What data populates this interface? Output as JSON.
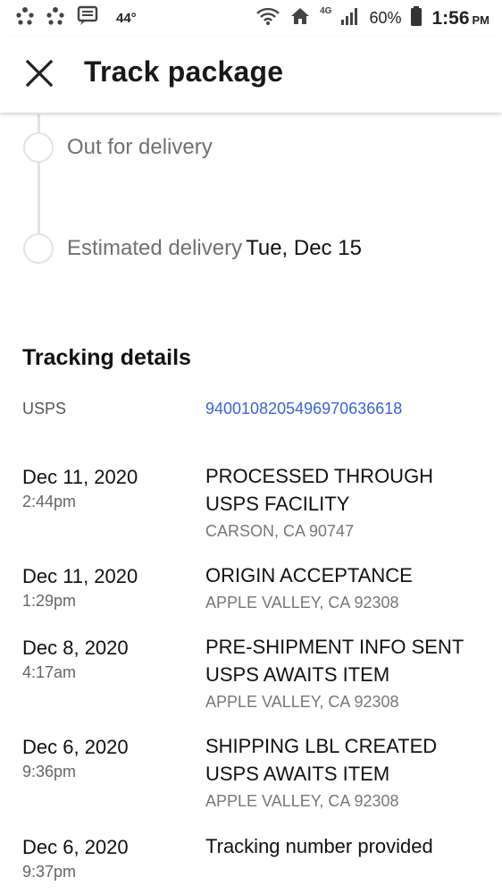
{
  "status_bar": {
    "temperature": "44°",
    "battery": "60%",
    "time": "1:56",
    "ampm": "PM",
    "network": "4G"
  },
  "header": {
    "title": "Track package",
    "close_icon": "close-icon"
  },
  "timeline": [
    {
      "label": "Out for delivery",
      "value": ""
    },
    {
      "label": "Estimated delivery",
      "value": "Tue, Dec 15"
    }
  ],
  "tracking": {
    "section_title": "Tracking details",
    "carrier": "USPS",
    "number": "9400108205496970636618"
  },
  "events": [
    {
      "date": "Dec 11, 2020",
      "time": "2:44pm",
      "description": "PROCESSED THROUGH USPS FACILITY",
      "location": "CARSON, CA 90747"
    },
    {
      "date": "Dec 11, 2020",
      "time": "1:29pm",
      "description": "ORIGIN ACCEPTANCE",
      "location": "APPLE VALLEY, CA 92308"
    },
    {
      "date": "Dec 8, 2020",
      "time": "4:17am",
      "description": "PRE-SHIPMENT INFO SENT USPS AWAITS ITEM",
      "location": "APPLE VALLEY, CA 92308"
    },
    {
      "date": "Dec 6, 2020",
      "time": "9:36pm",
      "description": "SHIPPING LBL CREATED  USPS AWAITS ITEM",
      "location": "APPLE VALLEY, CA 92308"
    },
    {
      "date": "Dec 6, 2020",
      "time": "9:37pm",
      "description": "Tracking number provided",
      "location": ""
    }
  ],
  "colors": {
    "link": "#3665d6",
    "muted": "#707070"
  }
}
